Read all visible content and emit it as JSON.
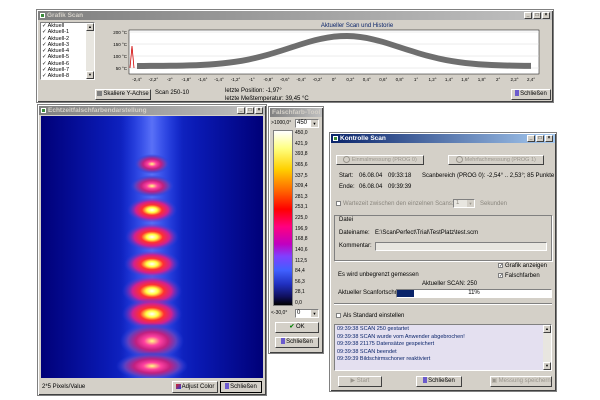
{
  "grafik": {
    "title": "Grafik Scan",
    "channels": [
      "Aktuell",
      "Aktuell-1",
      "Aktuell-2",
      "Aktuell-3",
      "Aktuell-4",
      "Aktuell-5",
      "Aktuell-6",
      "Aktuell-7",
      "Aktuell-8"
    ],
    "chart_title": "Aktueller Scan und Historie",
    "y_ticks": [
      "200 °C",
      "150 °C",
      "100 °C",
      "50 °C"
    ],
    "x_ticks": [
      "-2,4°",
      "-2,2°",
      "-2°",
      "-1,8°",
      "-1,6°",
      "-1,4°",
      "-1,2°",
      "-1°",
      "-0,8°",
      "-0,6°",
      "-0,4°",
      "-0,2°",
      "0°",
      "0,2°",
      "0,4°",
      "0,6°",
      "0,8°",
      "1°",
      "1,2°",
      "1,4°",
      "1,6°",
      "1,8°",
      "2°",
      "2,2°",
      "2,4°"
    ],
    "scale_button": "Skaliere Y-Achse",
    "scan_label": "Scan 250-10",
    "position_label": "letzte Position: -1,97°",
    "temp_label": "letzte Meßtemperatur: 39,45 °C",
    "close_button": "Schließen"
  },
  "echtzeit": {
    "title": "Echtzeitfalschfarbendarstellung",
    "status": "2*5 Pixels/Value",
    "adjust_button": "Adjust Color",
    "close_button": "Schließen"
  },
  "falschfarb": {
    "title": "Falschfarb-Tool",
    "top_label": ">1000,0°",
    "top_value": "450",
    "scale_values": [
      "450,0",
      "421,9",
      "393,8",
      "365,6",
      "337,5",
      "309,4",
      "281,3",
      "253,1",
      "225,0",
      "196,9",
      "168,8",
      "140,6",
      "112,5",
      "84,4",
      "56,3",
      "28,1",
      "0,0"
    ],
    "bottom_label": "<-30,0°",
    "bottom_value": "0",
    "ok_button": "OK",
    "close_button": "Schließen"
  },
  "kontrolle": {
    "title": "Kontrolle Scan",
    "radio1": "Einmalmessung (PROG 0)",
    "radio2": "Mehrfachmessung (PROG 1)",
    "start_label": "Start:",
    "start_date": "06.08.04",
    "start_time": "09:33:18",
    "end_label": "Ende:",
    "end_date": "06.08.04",
    "end_time": "09:39:39",
    "range_text": "Scanbereich (PROG 0): -2,54° .. 2,53°; 85 Punkte",
    "wait_label": "Wartezeit zwischen den einzelnen Scans:",
    "wait_value": "1",
    "wait_unit": "Sekunden",
    "datei_group": "Datei",
    "dateiname_label": "Dateiname:",
    "dateiname_value": "E:\\ScanPerfect\\Trial\\TestPlatz\\test.scm",
    "kommentar_label": "Kommentar:",
    "grafik_check": "Grafik anzeigen",
    "falschfarben_check": "Falschfarben",
    "unbegrenzt": "Es wird unbegrenzt gemessen",
    "aktueller_scan": "Aktueller SCAN: 250",
    "fortschritt_label": "Aktueller Scanfortschritt",
    "progress_percent": 11,
    "progress_text": "11%",
    "standard_check": "Als Standard einstellen",
    "log": [
      "09:39:38 SCAN 250 gestartet",
      "09:39:38 SCAN wurde vom Anwender abgebrochen!",
      "09:39:38 21175 Datensätze gespeichert",
      "09:39:38 SCAN beendet",
      "09:39:39 Bildschirmschoner reaktiviert"
    ],
    "start_button": "Start",
    "close_button": "Schließen",
    "messung_button": "Messung speichern"
  }
}
